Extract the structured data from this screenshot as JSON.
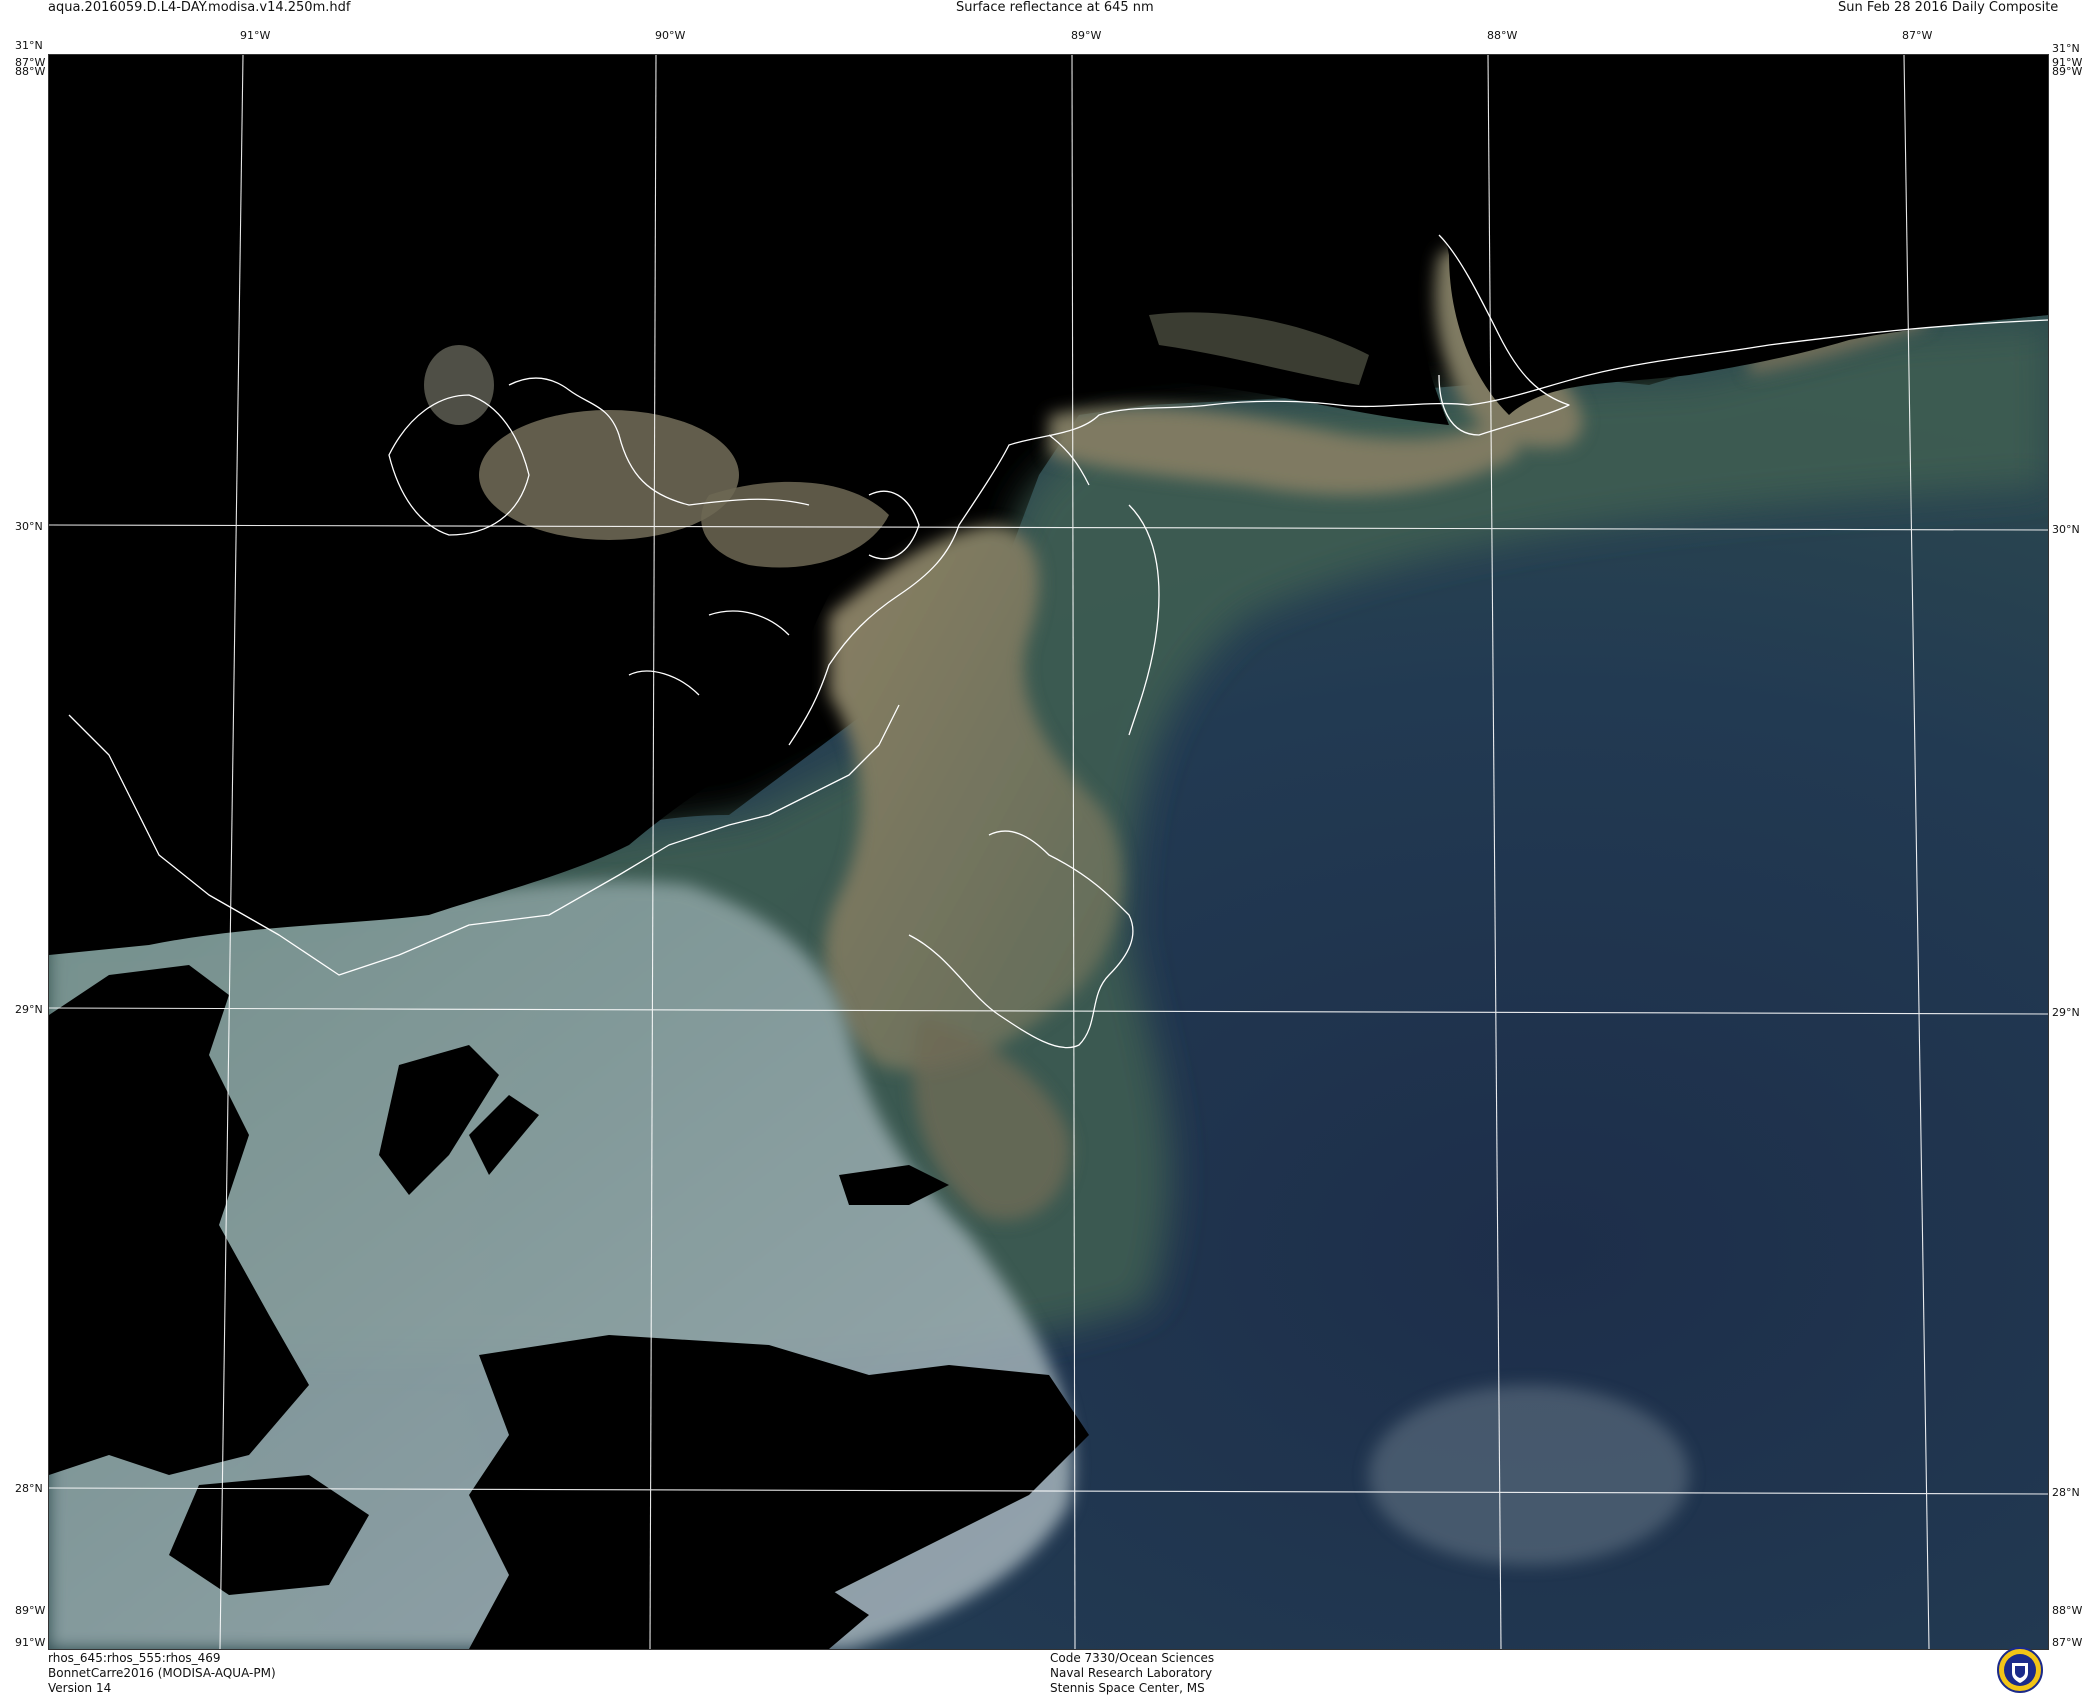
{
  "header": {
    "filename": "aqua.2016059.D.L4-DAY.modisa.v14.250m.hdf",
    "title": "Surface reflectance at 645 nm",
    "date": "Sun Feb 28 2016 Daily Composite"
  },
  "grid": {
    "top_lon_labels": [
      "91°W",
      "90°W",
      "89°W",
      "88°W",
      "87°W"
    ],
    "top_left_corner": [
      "31°N",
      "87°W",
      "88°W"
    ],
    "top_right_corner": [
      "31°N",
      "91°W",
      "89°W"
    ],
    "left_lat_labels": [
      "30°N",
      "29°N",
      "28°N"
    ],
    "right_lat_labels": [
      "30°N",
      "29°N",
      "28°N"
    ],
    "bottom_left_corner": [
      "89°W",
      "91°W"
    ],
    "bottom_right_corner": [
      "88°W",
      "87°W"
    ]
  },
  "footer": {
    "left": [
      "rhos_645:rhos_555:rhos_469",
      "BonnetCarre2016 (MODISA-AQUA-PM)",
      "Version 14"
    ],
    "center": [
      "Code 7330/Ocean Sciences",
      "Naval Research Laboratory",
      "Stennis Space Center, MS"
    ],
    "logo": "NRL"
  },
  "colors": {
    "land_nodata": "#000000",
    "deep_water": "#1f3450",
    "sediment_plume": "#8a7f63",
    "coastal_green": "#3d5a4e",
    "cloud": "#a9b8b8",
    "gridline": "#ffffff"
  }
}
